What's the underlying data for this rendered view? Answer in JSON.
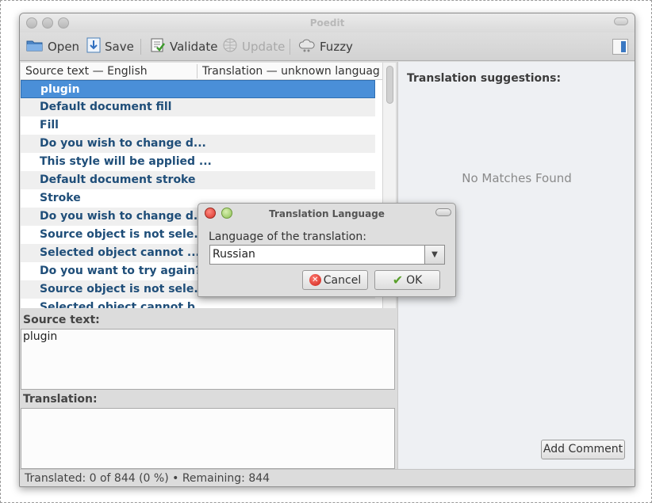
{
  "window": {
    "title": "Poedit"
  },
  "toolbar": {
    "items": [
      {
        "label": "Open",
        "icon": "folder-open-icon",
        "enabled": true
      },
      {
        "label": "Save",
        "icon": "save-icon",
        "enabled": true
      },
      {
        "label": "Validate",
        "icon": "validate-checklist-icon",
        "enabled": true
      },
      {
        "label": "Update",
        "icon": "update-globe-icon",
        "enabled": false
      },
      {
        "label": "Fuzzy",
        "icon": "fuzzy-cloud-icon",
        "enabled": true
      }
    ],
    "sidebar_toggle_icon": "sidebar-toggle-icon"
  },
  "list": {
    "columns": [
      "Source text — English",
      "Translation — unknown language"
    ],
    "rows": [
      {
        "source": "plugin",
        "translation": "",
        "selected": true
      },
      {
        "source": "Default document fill",
        "translation": ""
      },
      {
        "source": "Fill",
        "translation": ""
      },
      {
        "source": "Do you wish to change d...",
        "translation": ""
      },
      {
        "source": "This style will be applied ...",
        "translation": ""
      },
      {
        "source": "Default document stroke",
        "translation": ""
      },
      {
        "source": "Stroke",
        "translation": ""
      },
      {
        "source": "Do you wish to change d...",
        "translation": ""
      },
      {
        "source": "Source object is not sele...",
        "translation": ""
      },
      {
        "source": "Selected object cannot ...",
        "translation": ""
      },
      {
        "source": "Do you want to try again?",
        "translation": ""
      },
      {
        "source": "Source object is not sele...",
        "translation": ""
      },
      {
        "source": "Selected object cannot b...",
        "translation": ""
      }
    ]
  },
  "source_panel": {
    "label": "Source text:",
    "value": "plugin"
  },
  "translation_panel": {
    "label": "Translation:",
    "value": ""
  },
  "suggestions": {
    "title": "Translation suggestions:",
    "empty_text": "No Matches Found",
    "add_comment_label": "Add Comment"
  },
  "status": {
    "text": "Translated: 0 of 844 (0 %)  •  Remaining: 844"
  },
  "dialog": {
    "title": "Translation Language",
    "label": "Language of the translation:",
    "language_value": "Russian",
    "cancel_label": "Cancel",
    "ok_label": "OK"
  },
  "colors": {
    "selection": "#4a8fd8",
    "source_text": "#1f4e79",
    "window_bg": "#dcdcdc"
  }
}
